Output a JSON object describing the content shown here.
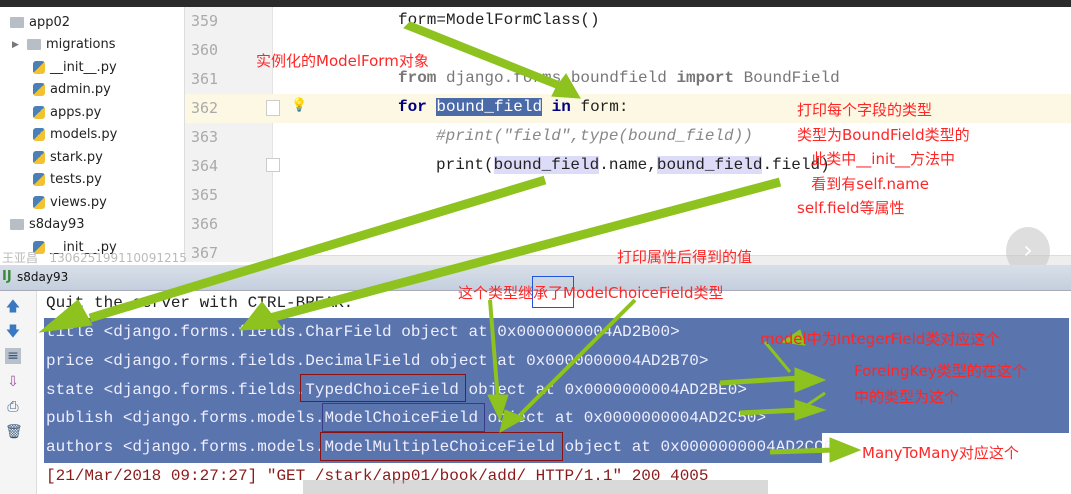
{
  "tree": {
    "items": [
      {
        "label": "app02",
        "type": "folder"
      },
      {
        "label": "migrations",
        "type": "folder"
      },
      {
        "label": "__init__.py",
        "type": "file"
      },
      {
        "label": "admin.py",
        "type": "file"
      },
      {
        "label": "apps.py",
        "type": "file"
      },
      {
        "label": "models.py",
        "type": "file"
      },
      {
        "label": "stark.py",
        "type": "file"
      },
      {
        "label": "tests.py",
        "type": "file"
      },
      {
        "label": "views.py",
        "type": "file"
      },
      {
        "label": "s8day93",
        "type": "folder"
      },
      {
        "label": "__init__.py",
        "type": "file"
      }
    ]
  },
  "editor": {
    "line_numbers": [
      "359",
      "360",
      "361",
      "362",
      "363",
      "364",
      "365",
      "366",
      "367"
    ],
    "lines": {
      "l359": "form=ModelFormClass()",
      "l361a": "from",
      "l361b": " django.forms.boundfield ",
      "l361c": "import",
      "l361d": " BoundField",
      "l362a": "for",
      "l362b": "bound_field",
      "l362c": "in",
      "l362d": " form:",
      "l363": "#print(\"field\",type(bound_field))",
      "l364a": "print(",
      "l364b": "bound_field",
      "l364c": ".name,",
      "l364d": "bound_field",
      "l364e": ".field)"
    }
  },
  "watermark": "王亚昌   130625199110091215",
  "run": {
    "title": "s8day93"
  },
  "console": {
    "lines": [
      "Quit the server with CTRL-BREAK.",
      "title <django.forms.fields.CharField object at 0x0000000004AD2B00>",
      "price <django.forms.fields.DecimalField object at 0x0000000004AD2B70>",
      "state <django.forms.fields.TypedChoiceField object at 0x0000000004AD2BE0>",
      "publish <django.forms.models.ModelChoiceField object at 0x0000000004AD2C50>",
      "authors <django.forms.models.ModelMultipleChoiceField object at 0x0000000004AD2CC0>"
    ],
    "log": "[21/Mar/2018 09:27:27] \"GET /stark/app01/book/add/ HTTP/1.1\" 200 4005"
  },
  "annotations": {
    "instantiate": "实例化的ModelForm对象",
    "print_type": "打印每个字段的类型\n类型为BoundField类型的\n   此类中__init__方法中\n   看到有self.name\nself.field等属性",
    "print_values": "打印属性后得到的值",
    "inherit": "这个类型继承了ModelChoiceField类型",
    "integer": "model中为IntegerField类对应这个",
    "foreignkey": "ForeingKey类型的在这个\n中的类型为这个",
    "m2m": "ManyToMany对应这个"
  },
  "colors": {
    "annotation": "#ff2626",
    "arrow": "#8dc21f",
    "selection": "#5a74ad"
  }
}
